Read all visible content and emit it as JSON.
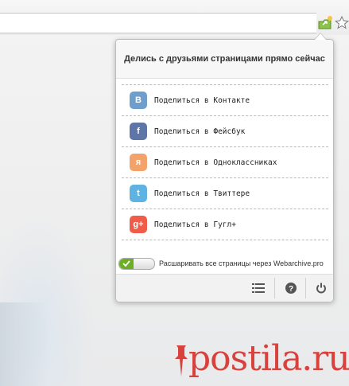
{
  "browser": {
    "extension_icon": "share-extension-icon",
    "bookmark_icon": "star-icon"
  },
  "popup": {
    "title": "Делись с друзьями страницами прямо сейчас",
    "share_items": [
      {
        "label": "Поделиться в Контакте",
        "icon": "vk-icon",
        "glyph": "В",
        "color": "#6e9fcc"
      },
      {
        "label": "Поделиться в Фейсбук",
        "icon": "facebook-icon",
        "glyph": "f",
        "color": "#5d76a7"
      },
      {
        "label": "Поделиться в Одноклассниках",
        "icon": "odnoklassniki-icon",
        "glyph": "я",
        "color": "#f3a36a"
      },
      {
        "label": "Поделиться в Твиттере",
        "icon": "twitter-icon",
        "glyph": "t",
        "color": "#5fb3e2"
      },
      {
        "label": "Поделиться в Гугл+",
        "icon": "google-plus-icon",
        "glyph": "g+",
        "color": "#ef5d48"
      }
    ],
    "toggle": {
      "label": "Расшаривать все страницы через Webarchive.pro",
      "on": true,
      "on_color": "#6dae27"
    },
    "footer": {
      "list_icon": "list-icon",
      "help_icon": "help-icon",
      "power_icon": "power-icon"
    }
  },
  "watermark": {
    "text": "postila.ru",
    "color": "#d8413c",
    "icon": "pin-icon"
  }
}
